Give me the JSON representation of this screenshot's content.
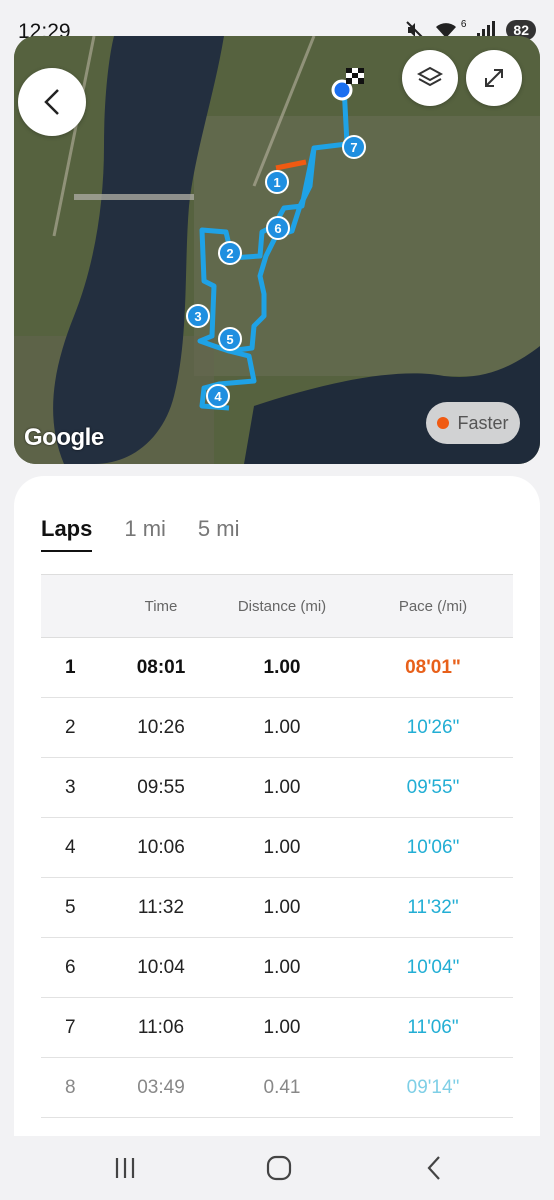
{
  "status_bar": {
    "time": "12:29",
    "wifi_badge": "6",
    "battery": "82"
  },
  "map": {
    "google_label": "Google",
    "legend_label": "Faster",
    "lap_markers": [
      "1",
      "2",
      "3",
      "4",
      "5",
      "6",
      "7"
    ],
    "route_color": "#1fa2e6",
    "fast_color": "#f05a12"
  },
  "tabs": [
    {
      "label": "Laps",
      "active": true
    },
    {
      "label": "1 mi",
      "active": false
    },
    {
      "label": "5 mi",
      "active": false
    }
  ],
  "table": {
    "headers": {
      "lap": "",
      "time": "Time",
      "distance": "Distance (mi)",
      "pace": "Pace (/mi)"
    },
    "rows": [
      {
        "lap": "1",
        "time": "08:01",
        "distance": "1.00",
        "pace": "08'01\""
      },
      {
        "lap": "2",
        "time": "10:26",
        "distance": "1.00",
        "pace": "10'26\""
      },
      {
        "lap": "3",
        "time": "09:55",
        "distance": "1.00",
        "pace": "09'55\""
      },
      {
        "lap": "4",
        "time": "10:06",
        "distance": "1.00",
        "pace": "10'06\""
      },
      {
        "lap": "5",
        "time": "11:32",
        "distance": "1.00",
        "pace": "11'32\""
      },
      {
        "lap": "6",
        "time": "10:04",
        "distance": "1.00",
        "pace": "10'04\""
      },
      {
        "lap": "7",
        "time": "11:06",
        "distance": "1.00",
        "pace": "11'06\""
      },
      {
        "lap": "8",
        "time": "03:49",
        "distance": "0.41",
        "pace": "09'14\""
      }
    ]
  },
  "icons": {
    "back": "back-arrow-icon",
    "layers": "layers-icon",
    "expand": "expand-icon",
    "nav_recents": "recents-icon",
    "nav_home": "home-icon",
    "nav_back": "nav-back-icon"
  }
}
